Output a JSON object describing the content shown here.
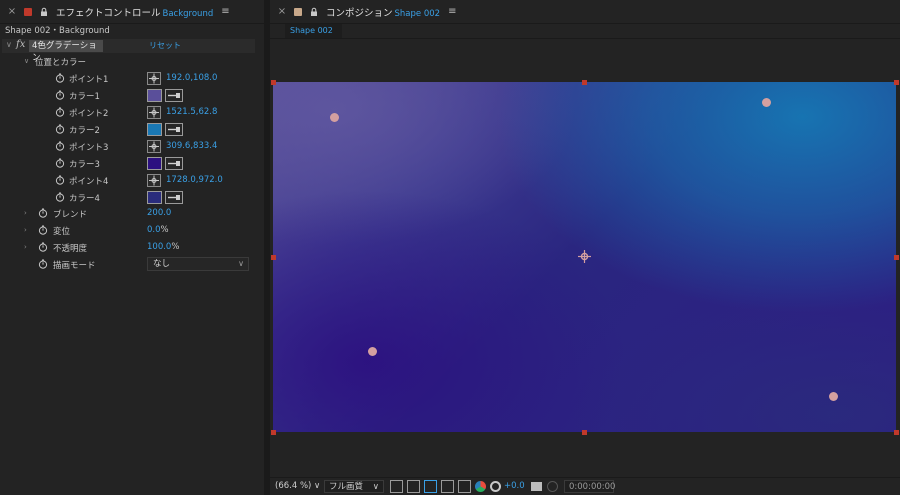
{
  "effect_panel": {
    "title": "エフェクトコントロール",
    "layer_name": "Background",
    "path": "Shape 002・Background",
    "effect": {
      "fx_label": "fx",
      "name": "4色グラデーション",
      "reset_label": "リセット"
    },
    "group_label": "位置とカラー",
    "properties": [
      {
        "label": "ポイント1",
        "type": "point",
        "value": "192.0,108.0"
      },
      {
        "label": "カラー1",
        "type": "color",
        "color": "#5a4f9a"
      },
      {
        "label": "ポイント2",
        "type": "point",
        "value": "1521.5,62.8"
      },
      {
        "label": "カラー2",
        "type": "color",
        "color": "#1a78b4"
      },
      {
        "label": "ポイント3",
        "type": "point",
        "value": "309.6,833.4"
      },
      {
        "label": "カラー3",
        "type": "color",
        "color": "#2c1080"
      },
      {
        "label": "ポイント4",
        "type": "point",
        "value": "1728.0,972.0"
      },
      {
        "label": "カラー4",
        "type": "color",
        "color": "#2a2c7c"
      }
    ],
    "blend": {
      "label": "ブレンド",
      "value": "200.0"
    },
    "jitter": {
      "label": "変位",
      "value": "0.0",
      "unit": "%"
    },
    "opacity": {
      "label": "不透明度",
      "value": "100.0",
      "unit": "%"
    },
    "blend_mode": {
      "label": "描画モード",
      "value": "なし"
    }
  },
  "comp_panel": {
    "title": "コンポジション",
    "comp_name": "Shape 002",
    "subtab": "Shape 002",
    "zoom": "(66.4 %)",
    "resolution": "フル画質",
    "exposure": "+0.0",
    "timecode": "0:00:00:00"
  },
  "colors": {
    "accent": "#3aa0e6",
    "handle": "#c0392b"
  }
}
